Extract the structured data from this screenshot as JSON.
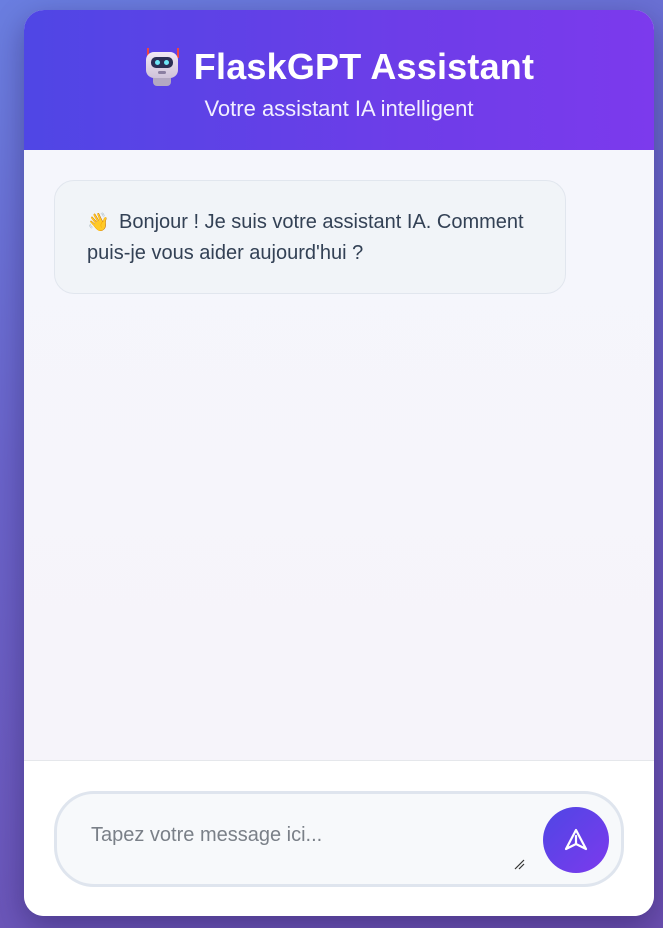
{
  "header": {
    "title": "FlaskGPT Assistant",
    "subtitle": "Votre assistant IA intelligent",
    "icon": "robot-icon"
  },
  "chat": {
    "messages": [
      {
        "role": "assistant",
        "emoji": "👋",
        "emoji_icon": "waving-hand-icon",
        "text": "Bonjour ! Je suis votre assistant IA. Comment puis-je vous aider aujourd'hui ?"
      }
    ]
  },
  "composer": {
    "placeholder": "Tapez votre message ici...",
    "value": "",
    "send_icon": "send-icon"
  },
  "colors": {
    "accent_start": "#4f46e5",
    "accent_end": "#7c3aed",
    "bubble_bg": "#f1f4f8",
    "text": "#334155"
  }
}
